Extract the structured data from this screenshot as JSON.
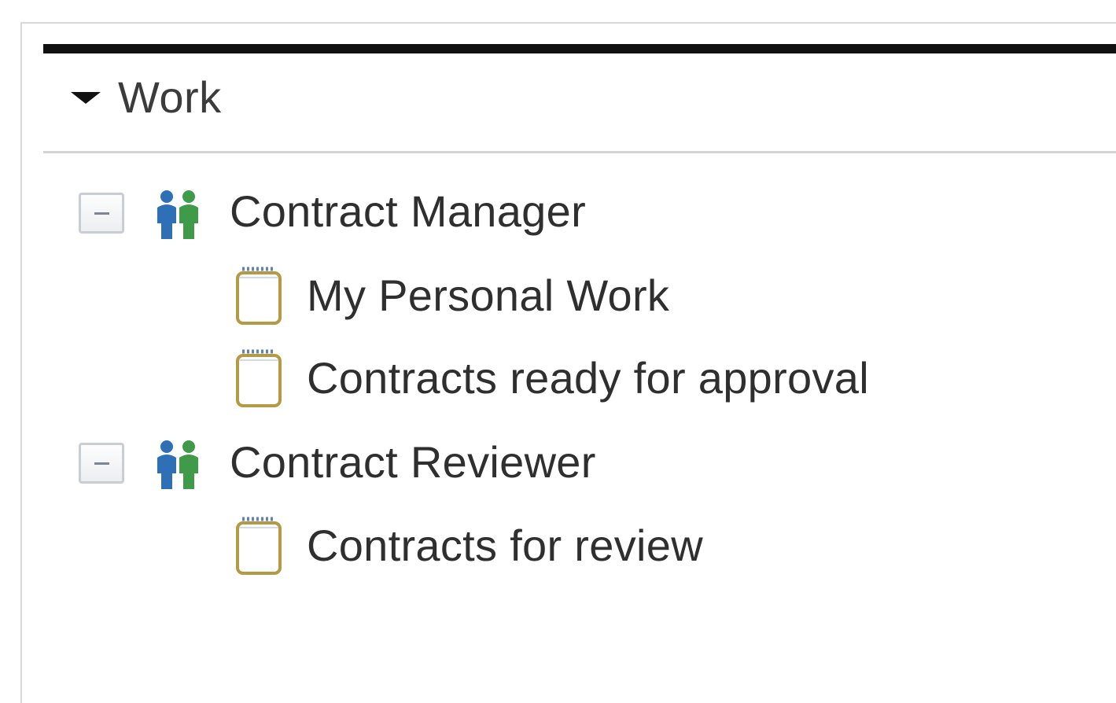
{
  "section": {
    "title": "Work",
    "expanded": true
  },
  "tree": {
    "groups": [
      {
        "label": "Contract Manager",
        "icon": "people-icon",
        "expanded": true,
        "items": [
          {
            "label": "My Personal Work",
            "icon": "document-icon"
          },
          {
            "label": "Contracts ready for approval",
            "icon": "document-icon"
          }
        ]
      },
      {
        "label": "Contract Reviewer",
        "icon": "people-icon",
        "expanded": true,
        "items": [
          {
            "label": "Contracts for review",
            "icon": "document-icon"
          }
        ]
      }
    ]
  },
  "colors": {
    "header_rule": "#111111",
    "text": "#2f2f2f",
    "divider": "#d4d4d4",
    "person_blue": "#2f6fb5",
    "person_green": "#3f9a4a",
    "doc_border": "#b59a45"
  }
}
